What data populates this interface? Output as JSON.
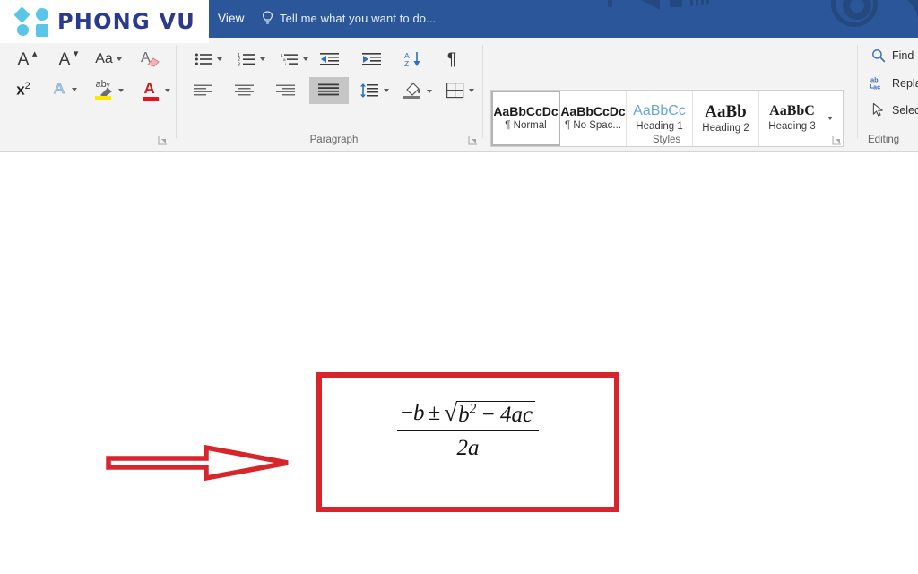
{
  "brand": {
    "logo_text": "PHONG VU",
    "accent_shape_color": "#59c6e8",
    "wordmark_color": "#2c3a8c"
  },
  "titlebar": {
    "background_color": "#2b579a",
    "tab_view": "View",
    "tell_me": {
      "icon": "lightbulb-icon",
      "placeholder": "Tell me what you want to do..."
    }
  },
  "ribbon": {
    "font_group": {
      "label": "",
      "buttons": [
        {
          "name": "grow-font",
          "glyph": "A",
          "sub": "grow-font-icon"
        },
        {
          "name": "shrink-font",
          "glyph": "A",
          "sub": "shrink-font-icon"
        },
        {
          "name": "change-case",
          "glyph": "Aa",
          "sub": "change-case-icon"
        },
        {
          "name": "clear-formatting",
          "glyph": "A",
          "sub": "clear-formatting-icon"
        },
        {
          "name": "superscript",
          "glyph": "x2",
          "sub": "superscript-icon"
        },
        {
          "name": "text-effects",
          "glyph": "A",
          "sub": "text-effects-icon"
        },
        {
          "name": "text-highlight-color",
          "glyph": "ab",
          "sub": "highlight-icon"
        },
        {
          "name": "font-color",
          "glyph": "A",
          "sub": "font-color-icon"
        }
      ],
      "launcher": "dialog-launcher-icon"
    },
    "paragraph_group": {
      "label": "Paragraph",
      "buttons": [
        {
          "name": "bullets",
          "icon": "bullet-list-icon",
          "has_caret": true
        },
        {
          "name": "numbering",
          "icon": "numbered-list-icon",
          "has_caret": true
        },
        {
          "name": "multilevel-list",
          "icon": "multilevel-list-icon",
          "has_caret": true
        },
        {
          "name": "decrease-indent",
          "icon": "decrease-indent-icon",
          "has_caret": false
        },
        {
          "name": "increase-indent",
          "icon": "increase-indent-icon",
          "has_caret": false
        },
        {
          "name": "sort",
          "icon": "sort-az-icon",
          "has_caret": false
        },
        {
          "name": "show-formatting-marks",
          "icon": "pilcrow-icon",
          "has_caret": false
        },
        {
          "name": "align-left",
          "icon": "align-left-icon",
          "has_caret": false
        },
        {
          "name": "align-center",
          "icon": "align-center-icon",
          "has_caret": false
        },
        {
          "name": "align-right",
          "icon": "align-right-icon",
          "has_caret": false
        },
        {
          "name": "justify",
          "icon": "justify-icon",
          "has_caret": false,
          "selected": true
        },
        {
          "name": "line-spacing",
          "icon": "line-spacing-icon",
          "has_caret": true
        },
        {
          "name": "shading",
          "icon": "shading-bucket-icon",
          "has_caret": true
        },
        {
          "name": "borders",
          "icon": "borders-icon",
          "has_caret": true
        }
      ],
      "launcher": "dialog-launcher-icon"
    },
    "styles_group": {
      "label": "Styles",
      "items": [
        {
          "preview": "AaBbCcDc",
          "name": "¶ Normal",
          "selected": true,
          "kind": "normal"
        },
        {
          "preview": "AaBbCcDc",
          "name": "¶ No Spac...",
          "selected": false,
          "kind": "normal"
        },
        {
          "preview": "AaBbCc",
          "name": "Heading 1",
          "selected": false,
          "kind": "h1"
        },
        {
          "preview": "AaBb",
          "name": "Heading 2",
          "selected": false,
          "kind": "h2"
        },
        {
          "preview": "AaBbC",
          "name": "Heading 3",
          "selected": false,
          "kind": "h3"
        }
      ],
      "more_icon": "chevron-down-icon",
      "launcher": "dialog-launcher-icon"
    },
    "editing_group": {
      "label": "Editing",
      "items": [
        {
          "name": "find",
          "label": "Find",
          "icon": "search-icon"
        },
        {
          "name": "replace",
          "label": "Repla",
          "icon": "replace-icon"
        },
        {
          "name": "select",
          "label": "Selec",
          "icon": "cursor-select-icon"
        }
      ]
    }
  },
  "document": {
    "equation": {
      "description": "quadratic-formula",
      "numerator_minus": "−",
      "numerator_b": "b",
      "plus_minus": "±",
      "radical_sign": "√",
      "radicand_b": "b",
      "radicand_exponent": "2",
      "radicand_minus": "−",
      "radicand_4ac": "4ac",
      "denominator": "2a",
      "plain_text": "(−b ± √(b² − 4ac)) / 2a"
    },
    "highlight_box_color": "#d8252b",
    "arrow": {
      "name": "pointer-arrow",
      "stroke_color": "#d8252b",
      "fill_color": "#ffffff",
      "direction": "right"
    }
  }
}
